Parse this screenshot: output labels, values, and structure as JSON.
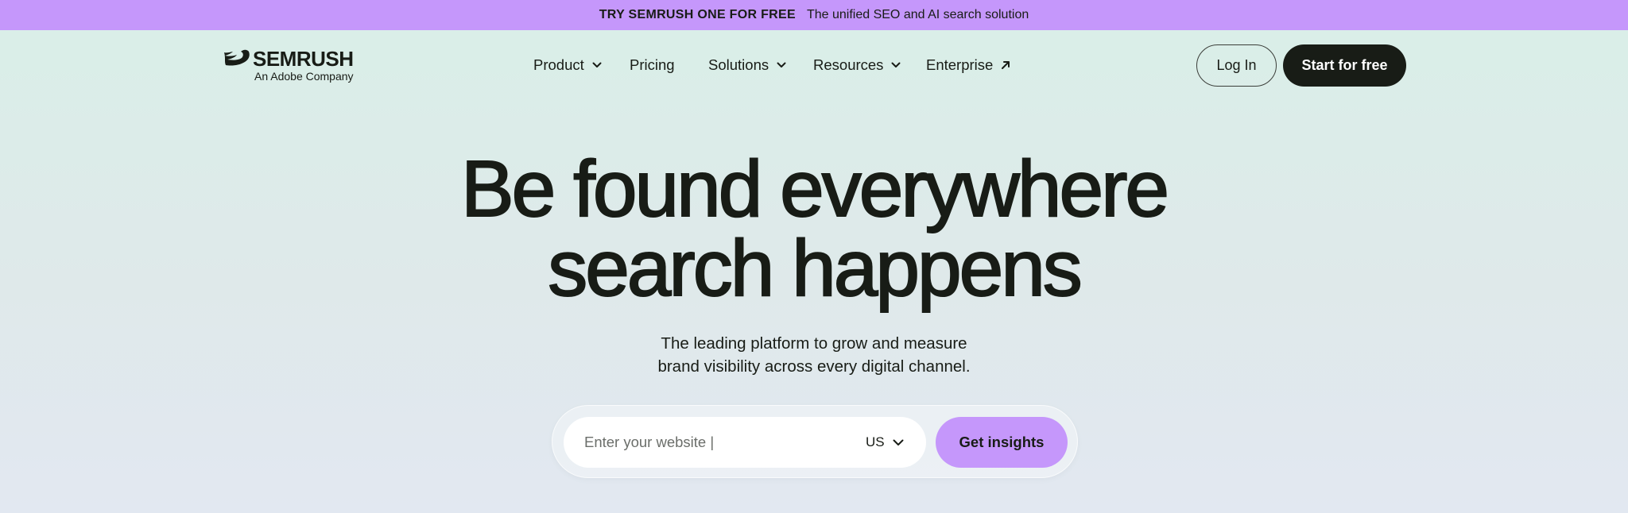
{
  "promo": {
    "cta": "TRY SEMRUSH ONE FOR FREE",
    "text": "The unified SEO and AI search solution",
    "background": "#c597fb"
  },
  "brand": {
    "name": "SEMRUSH",
    "tagline": "An Adobe Company",
    "icon": "semrush-fireball-icon"
  },
  "nav": {
    "items": [
      {
        "label": "Product",
        "icon": "chevron-down-icon"
      },
      {
        "label": "Pricing"
      },
      {
        "label": "Solutions",
        "icon": "chevron-down-icon"
      },
      {
        "label": "Resources",
        "icon": "chevron-down-icon"
      },
      {
        "label": "Enterprise",
        "icon": "arrow-up-right-icon"
      }
    ]
  },
  "auth": {
    "login_label": "Log In",
    "start_label": "Start for free"
  },
  "hero": {
    "title_line1": "Be found everywhere",
    "title_line2": "search happens",
    "subtitle_line1": "The leading platform to grow and measure",
    "subtitle_line2": "brand visibility across every digital channel."
  },
  "search": {
    "placeholder": "Enter your website |",
    "country": "US",
    "country_icon": "chevron-down-icon",
    "submit_label": "Get insights"
  },
  "colors": {
    "accent": "#c597fb",
    "dark": "#181c16",
    "background_top": "#d9efe8",
    "background_bottom": "#e2e8f1"
  }
}
